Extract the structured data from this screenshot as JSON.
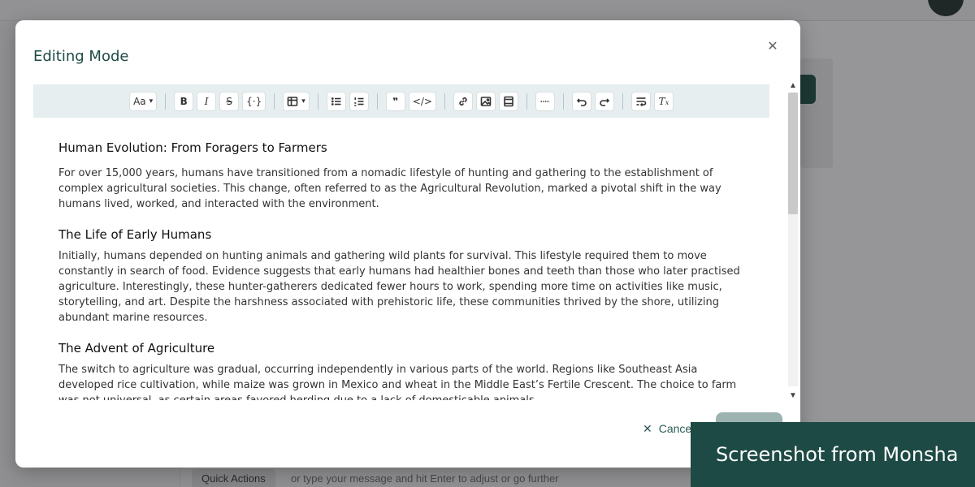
{
  "background": {
    "quick_actions_label": "Quick Actions",
    "prompt_placeholder": "or type your message and hit Enter to adjust or go further"
  },
  "modal": {
    "title": "Editing Mode",
    "close_icon": "close-icon",
    "cancel_label": "Cancel",
    "save_label": ""
  },
  "toolbar": {
    "font_size_label": "Aa",
    "buttons": [
      "bold-icon",
      "italic-icon",
      "strikethrough-icon",
      "code-icon",
      "table-icon",
      "bullet-list-icon",
      "ordered-list-icon",
      "blockquote-icon",
      "code-block-icon",
      "link-icon",
      "image-icon",
      "video-icon",
      "horizontal-rule-icon",
      "undo-icon",
      "redo-icon",
      "wrap-icon",
      "clear-format-icon"
    ]
  },
  "document": {
    "sections": [
      {
        "heading": "Human Evolution: From Foragers to Farmers",
        "body": "For over 15,000 years, humans have transitioned from a nomadic lifestyle of hunting and gathering to the establishment of complex agricultural societies. This change, often referred to as the Agricultural Revolution, marked a pivotal shift in the way humans lived, worked, and interacted with the environment."
      },
      {
        "heading": "The Life of Early Humans",
        "body": "Initially, humans depended on hunting animals and gathering wild plants for survival. This lifestyle required them to move constantly in search of food. Evidence suggests that early humans had healthier bones and teeth than those who later practised agriculture. Interestingly, these hunter-gatherers dedicated fewer hours to work, spending more time on activities like music, storytelling, and art. Despite the harshness associated with prehistoric life, these communities thrived by the shore, utilizing abundant marine resources."
      },
      {
        "heading": "The Advent of Agriculture",
        "body": "The switch to agriculture was gradual, occurring independently in various parts of the world. Regions like Southeast Asia developed rice cultivation, while maize was grown in Mexico and wheat in the Middle East’s Fertile Crescent. The choice to farm was not universal, as certain areas favored herding due to a lack of domesticable animals."
      }
    ]
  },
  "watermark": "Screenshot from Monsha"
}
